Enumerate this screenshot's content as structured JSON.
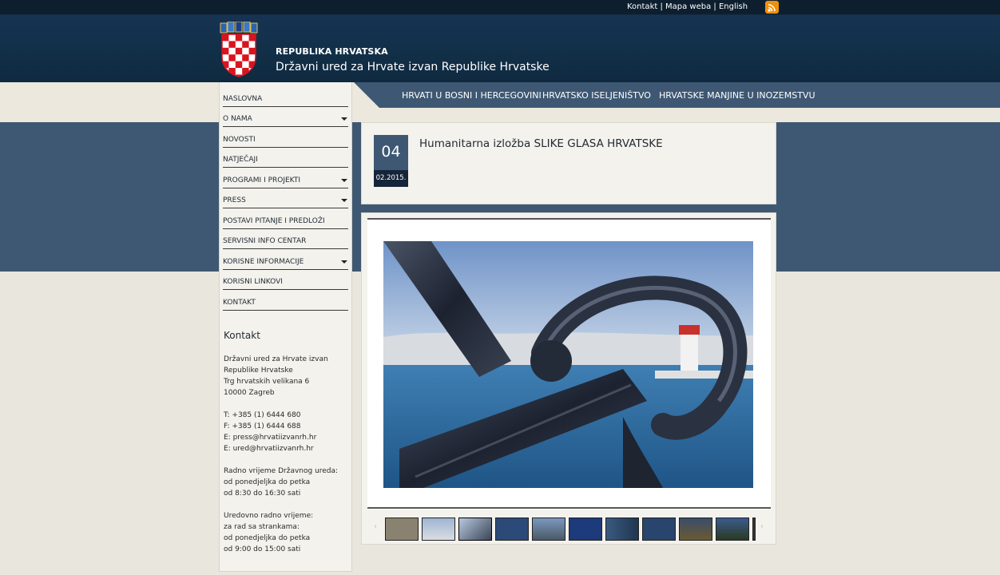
{
  "topbar": {
    "links": [
      "Kontakt",
      "Mapa weba",
      "English"
    ],
    "separator": " | ",
    "rss_icon": "rss-icon"
  },
  "header": {
    "republic": "REPUBLIKA HRVATSKA",
    "office": "Državni ured za Hrvate izvan Republike Hrvatske",
    "crest_icon": "croatian-coat-of-arms"
  },
  "topnav": [
    "HRVATI U BOSNI I HERCEGOVINI",
    "HRVATSKO ISELJENIŠTVO",
    "HRVATSKE MANJINE U INOZEMSTVU"
  ],
  "sidebar": {
    "menu": [
      {
        "label": "NASLOVNA",
        "submenu": false
      },
      {
        "label": "O NAMA",
        "submenu": true
      },
      {
        "label": "NOVOSTI",
        "submenu": false
      },
      {
        "label": "NATJEČAJI",
        "submenu": false
      },
      {
        "label": "PROGRAMI I PROJEKTI",
        "submenu": true
      },
      {
        "label": "PRESS",
        "submenu": true
      },
      {
        "label": "POSTAVI PITANJE I PREDLOŽI",
        "submenu": false
      },
      {
        "label": "SERVISNI INFO CENTAR",
        "submenu": false
      },
      {
        "label": "KORISNE INFORMACIJE",
        "submenu": true
      },
      {
        "label": "KORISNI LINKOVI",
        "submenu": false
      },
      {
        "label": "KONTAKT",
        "submenu": false
      }
    ],
    "contact_title": "Kontakt",
    "contact_lines": [
      "Državni ured za Hrvate izvan",
      "Republike Hrvatske",
      "Trg hrvatskih velikana 6",
      "10000 Zagreb",
      "",
      "T: +385 (1) 6444 680",
      "F: +385 (1) 6444 688",
      "E: press@hrvatiizvanrh.hr",
      "E: ured@hrvatiizvanrh.hr",
      "",
      "Radno vrijeme Državnog ureda:",
      "od ponedjeljka do petka",
      "od 8:30 do 16:30 sati",
      "",
      "Uredovno radno vrijeme:",
      "za rad sa strankama:",
      "od ponedjeljka do petka",
      "od 9:00 do 15:00 sati"
    ]
  },
  "article": {
    "day": "04",
    "date": "02.2015.",
    "title": "Humanitarna izložba SLIKE GLASA HRVATSKE"
  },
  "gallery": {
    "prev_icon": "chevron-left-icon",
    "next_icon": "chevron-right-icon",
    "thumbnail_count": 11,
    "colors": {
      "thumb1": "#8a8270",
      "thumb2": "#c9d2dd",
      "thumb3": "#6f7f94",
      "thumb4": "#2c4a78",
      "thumb5": "#6b7a86",
      "thumb6": "#1d3a7a",
      "thumb7": "#3a5a80",
      "thumb8": "#29456e",
      "thumb9": "#5a5030",
      "thumb10": "#3b5b8e"
    }
  }
}
